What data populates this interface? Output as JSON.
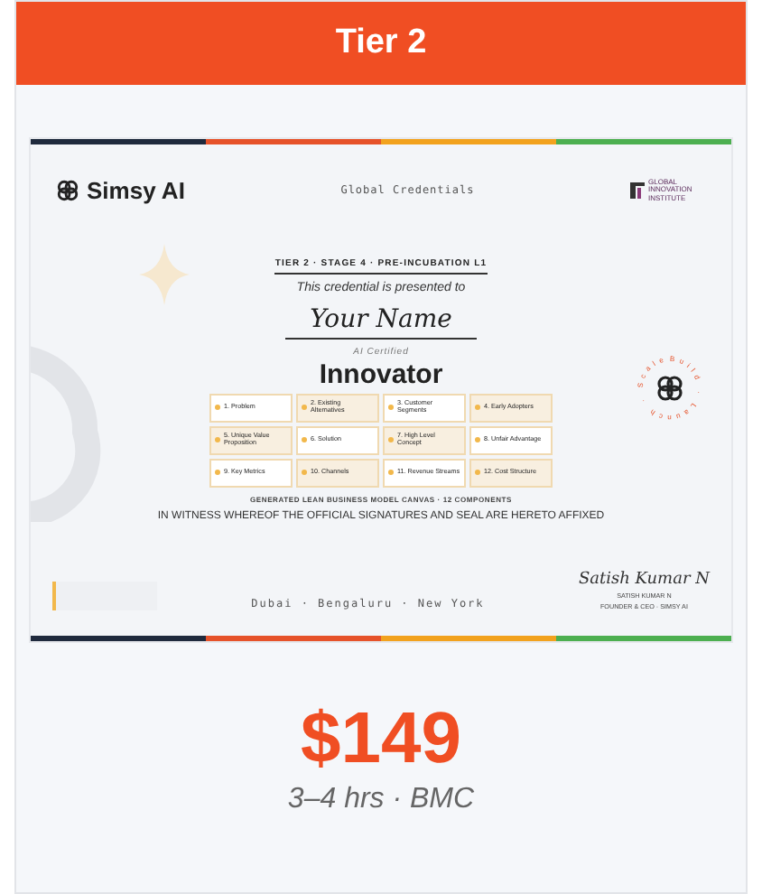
{
  "header": {
    "title": "Tier 2"
  },
  "certificate": {
    "brand": "Simsy AI",
    "center_title": "Global Credentials",
    "partner": "GLOBAL INNOVATION INSTITUTE",
    "tier_line": "TIER 2 · STAGE 4 · PRE-INCUBATION L1",
    "presented": "This credential is presented to",
    "name": "Your Name",
    "certified": "AI Certified",
    "award": "Innovator",
    "components": [
      {
        "label": "1. Problem"
      },
      {
        "label": "2. Existing Alternatives"
      },
      {
        "label": "3. Customer Segments"
      },
      {
        "label": "4. Early Adopters"
      },
      {
        "label": "5. Unique Value Proposition"
      },
      {
        "label": "6. Solution"
      },
      {
        "label": "7. High Level Concept"
      },
      {
        "label": "8. Unfair Advantage"
      },
      {
        "label": "9. Key Metrics"
      },
      {
        "label": "10. Channels"
      },
      {
        "label": "11. Revenue Streams"
      },
      {
        "label": "12. Cost Structure"
      }
    ],
    "canvas_note": "GENERATED LEAN BUSINESS MODEL CANVAS · 12 COMPONENTS",
    "witness": "IN WITNESS WHEREOF THE OFFICIAL SIGNATURES AND SEAL ARE HERETO AFFIXED",
    "cities": "Dubai · Bengaluru · New York",
    "signature": "Satish Kumar N",
    "signer": "SATISH KUMAR N",
    "signer_role": "FOUNDER & CEO · SIMSY AI",
    "seal_text": "Build · Launch · Scale"
  },
  "price": "$149",
  "details": "3–4 hrs · BMC"
}
